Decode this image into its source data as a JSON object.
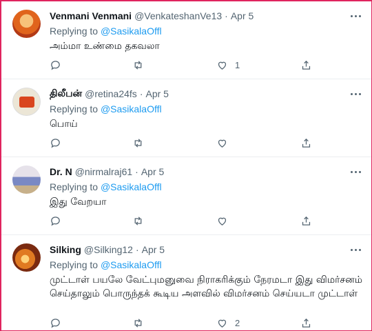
{
  "tweets": [
    {
      "name": "Venmani Venmani",
      "handle": "@VenkateshanVe13",
      "date": "Apr 5",
      "replying_prefix": "Replying to",
      "replying_to": "@SasikalaOffl",
      "text": "அம்மா உண்மை தகவலா",
      "like_count": "1",
      "avatar_colors": [
        "#f2a23a",
        "#c0392b"
      ]
    },
    {
      "name": "திலீபன்",
      "handle": "@retina24fs",
      "date": "Apr 5",
      "replying_prefix": "Replying to",
      "replying_to": "@SasikalaOffl",
      "text": "பொய்",
      "like_count": "",
      "avatar_colors": [
        "#e9e3d3",
        "#d9451e"
      ]
    },
    {
      "name": "Dr. N",
      "handle": "@nirmalraj61",
      "date": "Apr 5",
      "replying_prefix": "Replying to",
      "replying_to": "@SasikalaOffl",
      "text": "இது வேறயா",
      "like_count": "",
      "avatar_colors": [
        "#d7d2e0",
        "#5b6aa8"
      ]
    },
    {
      "name": "Silking",
      "handle": "@Silking12",
      "date": "Apr 5",
      "replying_prefix": "Replying to",
      "replying_to": "@SasikalaOffl",
      "text": "முட்டாள் பயலே வேட்புமனுவை நிராகரிக்கும் நேரமடா இது விமர்சனம் செய்தாலும் பொருந்தக் கூடிய அளவில் விமர்சனம் செய்யடா முட்டாள்",
      "like_count": "2",
      "avatar_colors": [
        "#f0a040",
        "#6b2410"
      ]
    }
  ],
  "icons": {
    "reply": "reply-icon",
    "retweet": "retweet-icon",
    "like": "like-icon",
    "share": "share-icon",
    "more": "more-icon"
  },
  "colors": {
    "accent": "#1d9bf0",
    "muted": "#536471",
    "frame_border": "#e0245e"
  }
}
